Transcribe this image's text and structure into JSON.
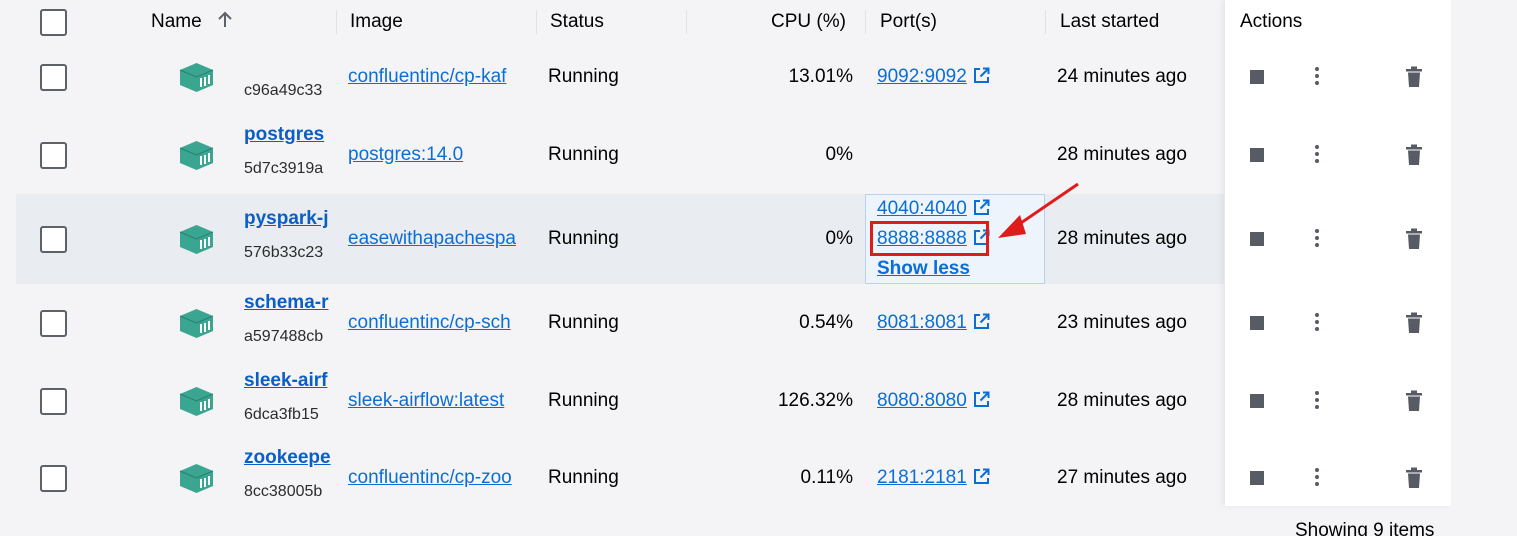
{
  "header": {
    "name": "Name",
    "sort_icon": "arrow-up-icon",
    "image": "Image",
    "status": "Status",
    "cpu": "CPU (%)",
    "ports": "Port(s)",
    "last_started": "Last started",
    "actions": "Actions"
  },
  "rows": [
    {
      "name": "",
      "id": "c96a49c33",
      "image": "confluentinc/cp-kaf",
      "status": "Running",
      "cpu": "13.01%",
      "ports": [
        "9092:9092"
      ],
      "last_started": "24 minutes ago"
    },
    {
      "name": "postgres",
      "id": "5d7c3919a",
      "image": "postgres:14.0",
      "status": "Running",
      "cpu": "0%",
      "ports": [],
      "last_started": "28 minutes ago"
    },
    {
      "name": "pyspark-j",
      "id": "576b33c23",
      "image": "easewithapachespa",
      "status": "Running",
      "cpu": "0%",
      "ports": [
        "4040:4040",
        "8888:8888"
      ],
      "show_less": "Show less",
      "last_started": "28 minutes ago"
    },
    {
      "name": "schema-r",
      "id": "a597488cb",
      "image": "confluentinc/cp-sch",
      "status": "Running",
      "cpu": "0.54%",
      "ports": [
        "8081:8081"
      ],
      "last_started": "23 minutes ago"
    },
    {
      "name": "sleek-airf",
      "id": "6dca3fb15",
      "image": "sleek-airflow:latest",
      "status": "Running",
      "cpu": "126.32%",
      "ports": [
        "8080:8080"
      ],
      "last_started": "28 minutes ago"
    },
    {
      "name": "zookeepe",
      "id": "8cc38005b",
      "image": "confluentinc/cp-zoo",
      "status": "Running",
      "cpu": "0.11%",
      "ports": [
        "2181:2181"
      ],
      "last_started": "27 minutes ago"
    }
  ],
  "footer": {
    "items_count": "Showing 9 items"
  },
  "colors": {
    "accent": "#0b6ed6",
    "container_icon": "#3aa590",
    "annotation": "#e01b1b"
  }
}
